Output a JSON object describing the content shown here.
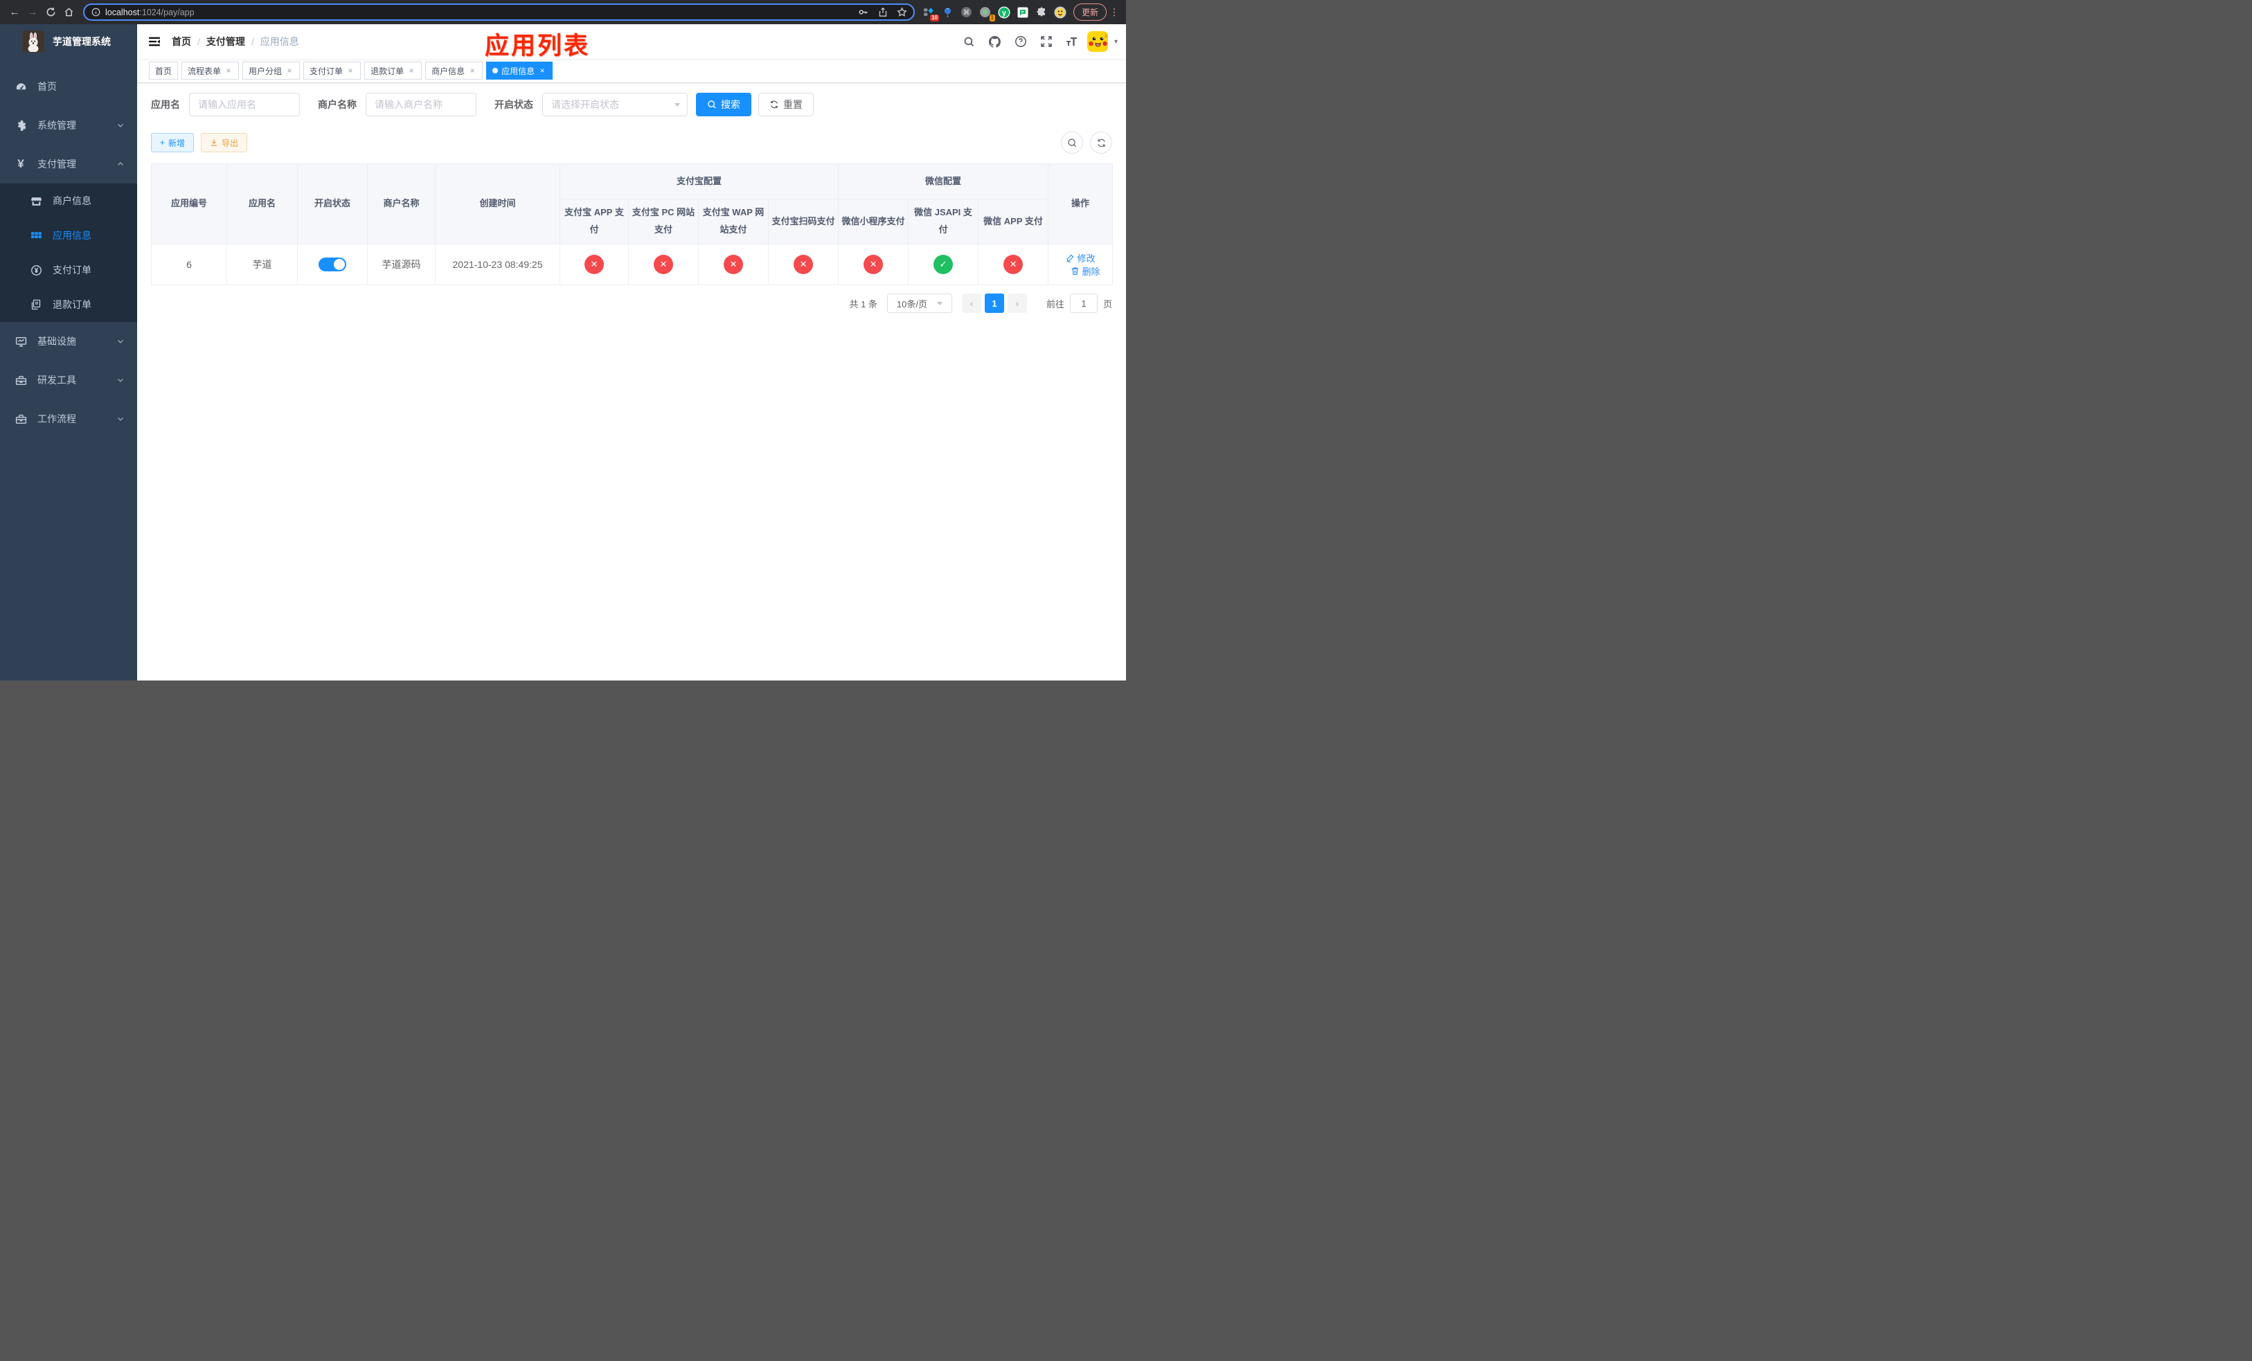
{
  "browser": {
    "url_host": "localhost",
    "url_rest": ":1024/pay/app",
    "update_label": "更新",
    "ext_badge_diamond": "10",
    "ext_badge_recorder": "1"
  },
  "ui": {
    "back_glyph": "←",
    "forward_glyph": "→",
    "dots_vertical": "⋮",
    "close_glyph": "×",
    "caret_down": "▾",
    "separator": "/",
    "plus_glyph": "+",
    "yen_glyph": "¥"
  },
  "sidebar": {
    "title": "芋道管理系统",
    "menu": [
      {
        "label": "首页"
      },
      {
        "label": "系统管理"
      },
      {
        "label": "支付管理"
      },
      {
        "label": "商户信息"
      },
      {
        "label": "应用信息"
      },
      {
        "label": "支付订单"
      },
      {
        "label": "退款订单"
      },
      {
        "label": "基础设施"
      },
      {
        "label": "研发工具"
      },
      {
        "label": "工作流程"
      }
    ]
  },
  "navbar": {
    "breadcrumb": {
      "home": "首页",
      "section": "支付管理",
      "current": "应用信息"
    }
  },
  "annotation": {
    "text": "应用列表",
    "color": "#fb2700"
  },
  "tags": [
    {
      "label": "首页"
    },
    {
      "label": "流程表单"
    },
    {
      "label": "用户分组"
    },
    {
      "label": "支付订单"
    },
    {
      "label": "退款订单"
    },
    {
      "label": "商户信息"
    },
    {
      "label": "应用信息"
    }
  ],
  "filters": {
    "app_name_label": "应用名",
    "app_name_placeholder": "请输入应用名",
    "merchant_label": "商户名称",
    "merchant_placeholder": "请输入商户名称",
    "status_label": "开启状态",
    "status_placeholder": "请选择开启状态",
    "search_label": "搜索",
    "reset_label": "重置"
  },
  "toolbar": {
    "add_label": "新增",
    "export_label": "导出"
  },
  "table": {
    "headers": {
      "app_id": "应用编号",
      "app_name": "应用名",
      "status": "开启状态",
      "merchant": "商户名称",
      "create_time": "创建时间",
      "alipay_group": "支付宝配置",
      "wechat_group": "微信配置",
      "alipay_app": "支付宝 APP 支付",
      "alipay_pc": "支付宝 PC 网站支付",
      "alipay_wap": "支付宝 WAP 网站支付",
      "alipay_qr": "支付宝扫码支付",
      "wx_mini": "微信小程序支付",
      "wx_jsapi": "微信 JSAPI 支付",
      "wx_app": "微信 APP 支付",
      "actions": "操作"
    },
    "row": {
      "app_id": "6",
      "app_name": "芋道",
      "enabled": true,
      "merchant": "芋道源码",
      "create_time": "2021-10-23 08:49:25",
      "config_flags": [
        false,
        false,
        false,
        false,
        false,
        true,
        false
      ],
      "edit_label": "修改",
      "delete_label": "删除"
    }
  },
  "pagination": {
    "total_text": "共 1 条",
    "page_size": "10条/页",
    "current_page": "1",
    "prev_glyph": "‹",
    "next_glyph": "›",
    "goto_label": "前往",
    "goto_value": "1",
    "page_suffix": "页"
  },
  "colors": {
    "accent": "#1890ff",
    "sidebar_bg": "#304156",
    "submenu_bg": "#1f2d3d",
    "success": "#1fbf62",
    "danger": "#f5494d",
    "warning": "#e6a23c",
    "annotation_red": "#fb2700"
  }
}
